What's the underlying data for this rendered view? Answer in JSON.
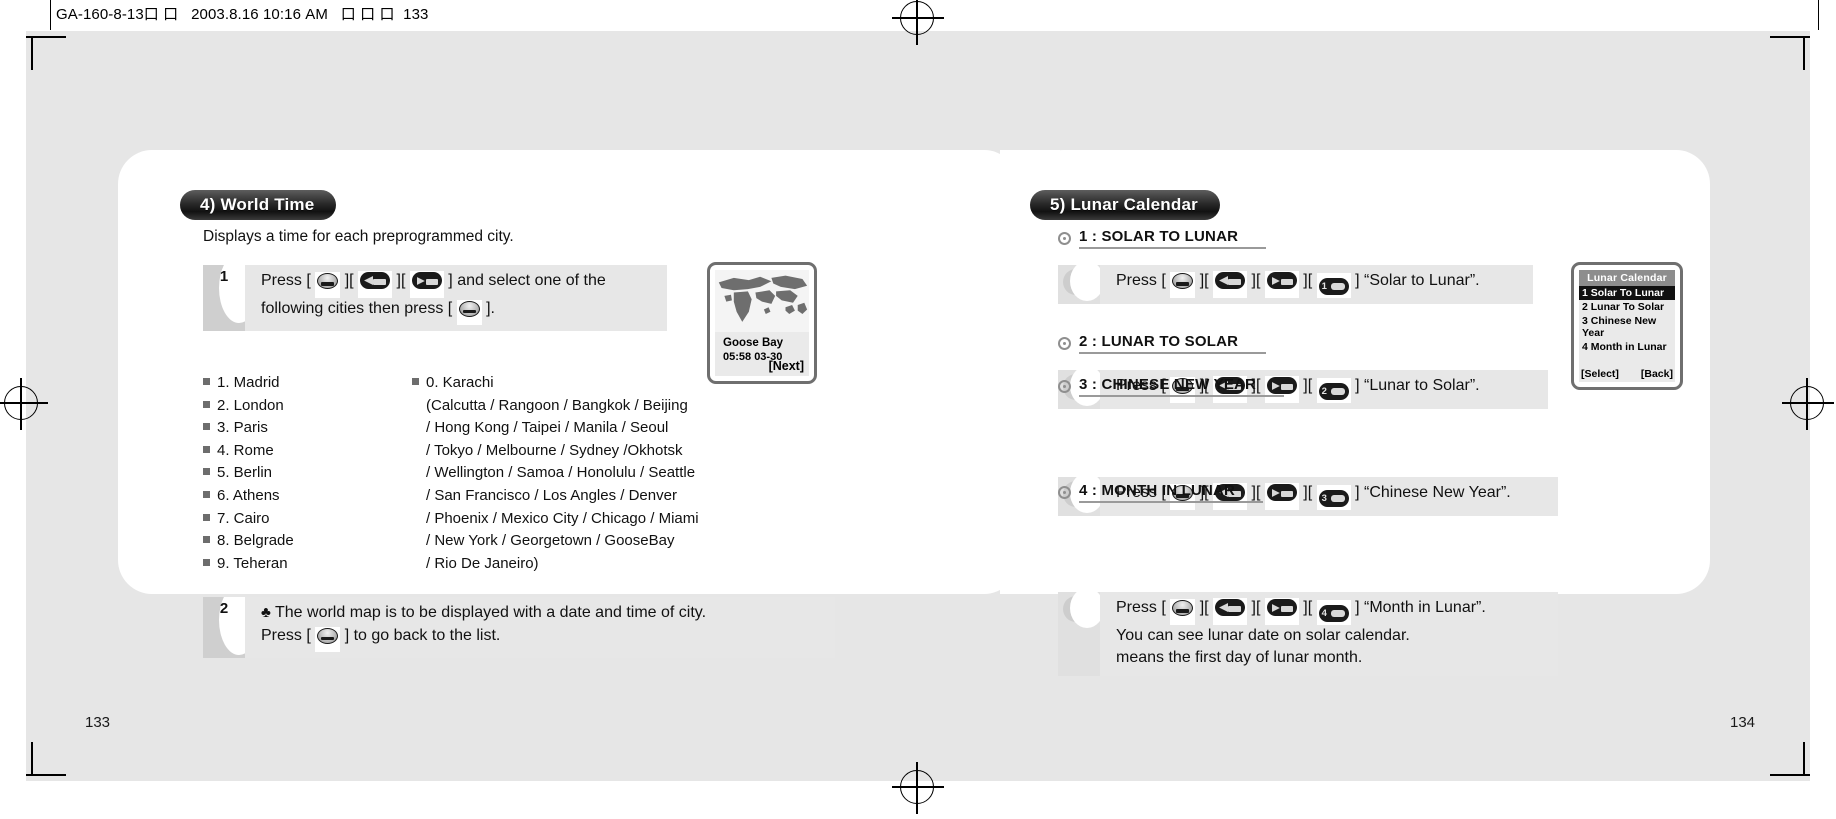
{
  "print_header": {
    "text": "GA-160-8-13口 口   2003.8.16 10:16 AM   口 口 口  133"
  },
  "colors": {
    "paper": "#e6e6e6",
    "panel": "#ffffff",
    "pill_dark": "#111111",
    "step_box": "#e7e7e7",
    "accent_grey": "#8f8f8f"
  },
  "left_page": {
    "page_number": "133",
    "section": {
      "title": "4) World Time"
    },
    "lead": "Displays a time for each preprogrammed city.",
    "step1": {
      "number": "1",
      "line1_a": "Press [",
      "line1_b": "][",
      "line1_c": "][",
      "line1_d": "] and select one of the",
      "line2_a": "following cities then  press [",
      "line2_b": "]."
    },
    "step2": {
      "number": "2",
      "bullet": "♣",
      "line1": "The world map is to be displayed with a date and time of city.",
      "line2_a": "Press [",
      "line2_b": "] to go back to the list."
    },
    "cities_left": [
      "1. Madrid",
      "2. London",
      "3. Paris",
      "4. Rome",
      "5. Berlin",
      "6. Athens",
      "7. Cairo",
      "8. Belgrade",
      "9. Teheran"
    ],
    "cities_right_first": "0. Karachi",
    "cities_right_cont": [
      "(Calcutta / Rangoon / Bangkok / Beijing",
      "/ Hong Kong / Taipei / Manila / Seoul",
      "/ Tokyo  / Melbourne / Sydney /Okhotsk",
      "/ Wellington / Samoa / Honolulu / Seattle",
      "/ San Francisco / Los Angles / Denver",
      "/ Phoenix / Mexico City / Chicago / Miami",
      "/ New York / Georgetown / GooseBay",
      "/ Rio De Janeiro)"
    ],
    "lcd": {
      "city": "Goose Bay",
      "time": "05:58 03-30",
      "softkey": "[Next]"
    }
  },
  "right_page": {
    "page_number": "134",
    "section": {
      "title": "5) Lunar Calendar"
    },
    "items": [
      {
        "heading": "1 : SOLAR TO LUNAR",
        "press_prefix": "Press [",
        "sep": "][",
        "suffix": "] “Solar to Lunar”.",
        "keys": [
          "ok-key",
          "nav-up-key",
          "nav-left-key",
          "num-1-key"
        ]
      },
      {
        "heading": "2 : LUNAR TO SOLAR",
        "press_prefix": "Press [",
        "sep": "][",
        "suffix": "] “Lunar to Solar”.",
        "keys": [
          "ok-key",
          "nav-up-key",
          "nav-left-key",
          "num-2-key"
        ]
      },
      {
        "heading": "3 : CHINESE NEW YEAR",
        "press_prefix": "Press [",
        "sep": "][",
        "suffix": "] “Chinese New Year”.",
        "keys": [
          "ok-key",
          "nav-up-key",
          "nav-left-key",
          "num-3-key"
        ]
      },
      {
        "heading": "4 : MONTH IN LUNAR",
        "press_prefix": "Press [",
        "sep": "][",
        "suffix": "] “Month in Lunar”.",
        "extra_line1": "You can see lunar date on solar calendar.",
        "extra_line2": "means the first day of lunar month.",
        "keys": [
          "ok-key",
          "nav-up-key",
          "nav-left-key",
          "num-4-key"
        ]
      }
    ],
    "lcd": {
      "title": "Lunar Calendar",
      "menu": [
        "1 Solar To Lunar",
        "2 Lunar To Solar",
        "3 Chinese New Year",
        "4 Month in Lunar"
      ],
      "selected_index": 0,
      "softkey_left": "[Select]",
      "softkey_right": "[Back]"
    }
  }
}
